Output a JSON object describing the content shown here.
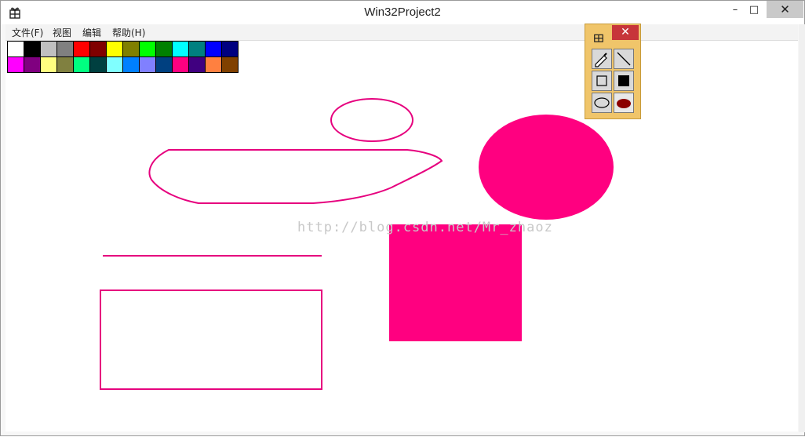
{
  "window": {
    "title": "Win32Project2",
    "minimize_glyph": "–",
    "maximize_glyph": "□",
    "close_glyph": "✕"
  },
  "menu": {
    "items": [
      "文件(F)",
      "视图",
      "编辑",
      "帮助(H)"
    ]
  },
  "palette": {
    "colors": [
      "#ffffff",
      "#000000",
      "#c0c0c0",
      "#808080",
      "#ff0000",
      "#800000",
      "#ffff00",
      "#808000",
      "#00ff00",
      "#008000",
      "#00ffff",
      "#008080",
      "#0000ff",
      "#000080",
      "#ff00ff",
      "#800080",
      "#ffff80",
      "#808040",
      "#00ff80",
      "#004040",
      "#80ffff",
      "#0080ff",
      "#8080ff",
      "#004080",
      "#ff0080",
      "#400080",
      "#ff8040",
      "#804000"
    ]
  },
  "canvas": {
    "stroke_color": "#e6007e",
    "fill_color": "#ff0080",
    "watermark": "http://blog.csdn.net/Mr_zhaoz"
  },
  "toolbox": {
    "close_glyph": "✕",
    "tools": [
      "pencil-tool",
      "line-tool",
      "rectangle-tool",
      "filled-rectangle-tool",
      "ellipse-tool",
      "filled-ellipse-tool"
    ],
    "filled_ellipse_color": "#8b0000"
  }
}
